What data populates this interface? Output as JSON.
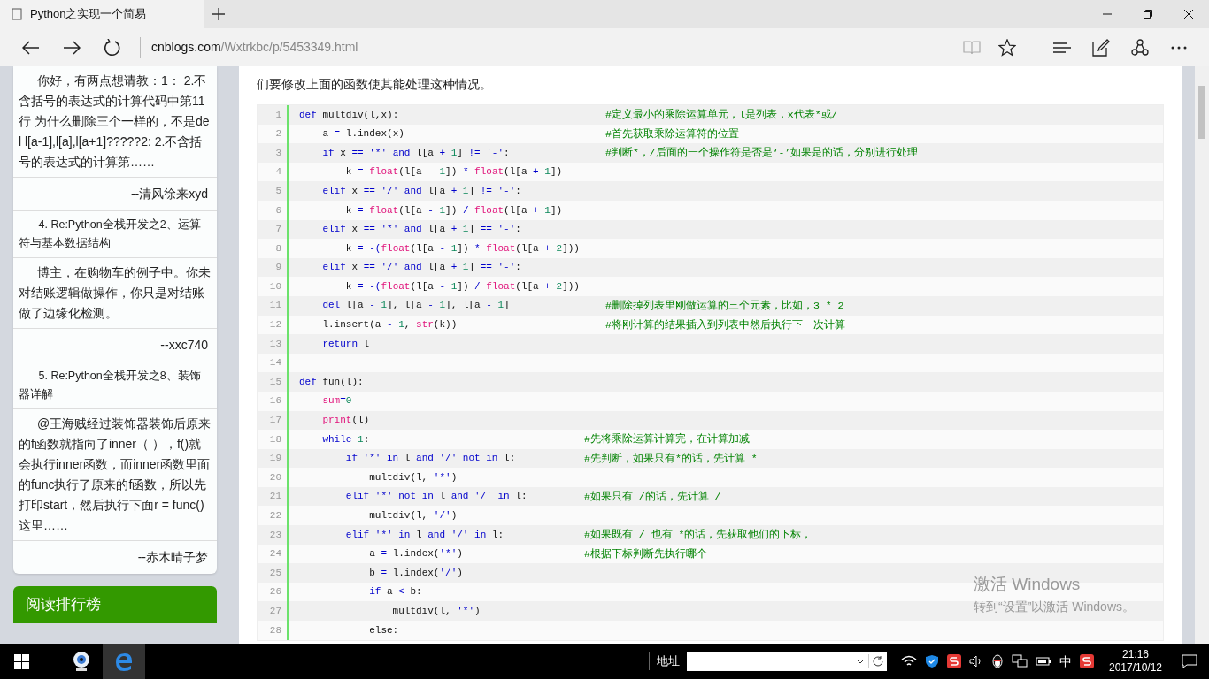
{
  "browser": {
    "tab_title": "Python之实现一个简易",
    "url_host": "cnblogs.com",
    "url_path": "/Wxtrkbc/p/5453349.html"
  },
  "sidebar": {
    "items": [
      {
        "kind": "comment",
        "text": "你好，有两点想请教：1： 2.不含括号的表达式的计算代码中第11行 为什么删除三个一样的，不是del l[a-1],l[a],l[a+1]?????2: 2.不含括号的表达式的计算第……"
      },
      {
        "kind": "author",
        "text": "--清风徐来xyd"
      },
      {
        "kind": "title",
        "text": "4. Re:Python全栈开发之2、运算符与基本数据结构"
      },
      {
        "kind": "comment",
        "text": "博主，在购物车的例子中。你未对结账逻辑做操作，你只是对结账做了边缘化检测。"
      },
      {
        "kind": "author",
        "text": "--xxc740"
      },
      {
        "kind": "title",
        "text": "5. Re:Python全栈开发之8、装饰器详解"
      },
      {
        "kind": "comment",
        "text": "@王海贼经过装饰器装饰后原来的f函数就指向了inner（ ），f()就会执行inner函数，而inner函数里面的func执行了原来的f函数，所以先打印start，然后执行下面r = func() 这里……"
      },
      {
        "kind": "author",
        "text": "--赤木晴子梦"
      }
    ],
    "section_title": "阅读排行榜"
  },
  "article": {
    "paragraph": "们要修改上面的函数使其能处理这种情况。",
    "code_lines": [
      {
        "number": "1",
        "tokens": [
          {
            "kind": "keyword",
            "text": "def"
          },
          {
            "kind": "plain",
            "text": " multdiv(l,x):"
          }
        ],
        "comment": "#定义最小的乘除运算单元，l是列表，x代表*或/"
      },
      {
        "number": "2",
        "tokens": [
          {
            "kind": "plain",
            "text": "    a "
          },
          {
            "kind": "operator",
            "text": "="
          },
          {
            "kind": "plain",
            "text": " l.index(x)"
          }
        ],
        "comment": "#首先获取乘除运算符的位置"
      },
      {
        "number": "3",
        "tokens": [
          {
            "kind": "keyword",
            "text": "    if"
          },
          {
            "kind": "plain",
            "text": " x "
          },
          {
            "kind": "operator",
            "text": "=="
          },
          {
            "kind": "string",
            "text": " '*'"
          },
          {
            "kind": "keyword",
            "text": " and"
          },
          {
            "kind": "plain",
            "text": " l[a "
          },
          {
            "kind": "operator",
            "text": "+"
          },
          {
            "kind": "number",
            "text": " 1"
          },
          {
            "kind": "plain",
            "text": "] "
          },
          {
            "kind": "operator",
            "text": "!="
          },
          {
            "kind": "string",
            "text": " '-'"
          },
          {
            "kind": "plain",
            "text": ":"
          }
        ],
        "comment": "#判断*，/后面的一个操作符是否是‘-’如果是的话，分别进行处理"
      },
      {
        "number": "4",
        "tokens": [
          {
            "kind": "plain",
            "text": "        k "
          },
          {
            "kind": "operator",
            "text": "="
          },
          {
            "kind": "builtin",
            "text": " float"
          },
          {
            "kind": "plain",
            "text": "(l[a "
          },
          {
            "kind": "operator",
            "text": "-"
          },
          {
            "kind": "number",
            "text": " 1"
          },
          {
            "kind": "plain",
            "text": "]) "
          },
          {
            "kind": "operator",
            "text": "*"
          },
          {
            "kind": "builtin",
            "text": " float"
          },
          {
            "kind": "plain",
            "text": "(l[a "
          },
          {
            "kind": "operator",
            "text": "+"
          },
          {
            "kind": "number",
            "text": " 1"
          },
          {
            "kind": "plain",
            "text": "])"
          }
        ]
      },
      {
        "number": "5",
        "tokens": [
          {
            "kind": "keyword",
            "text": "    elif"
          },
          {
            "kind": "plain",
            "text": " x "
          },
          {
            "kind": "operator",
            "text": "=="
          },
          {
            "kind": "string",
            "text": " '/'"
          },
          {
            "kind": "keyword",
            "text": " and"
          },
          {
            "kind": "plain",
            "text": " l[a "
          },
          {
            "kind": "operator",
            "text": "+"
          },
          {
            "kind": "number",
            "text": " 1"
          },
          {
            "kind": "plain",
            "text": "] "
          },
          {
            "kind": "operator",
            "text": "!="
          },
          {
            "kind": "string",
            "text": " '-'"
          },
          {
            "kind": "plain",
            "text": ":"
          }
        ]
      },
      {
        "number": "6",
        "tokens": [
          {
            "kind": "plain",
            "text": "        k "
          },
          {
            "kind": "operator",
            "text": "="
          },
          {
            "kind": "builtin",
            "text": " float"
          },
          {
            "kind": "plain",
            "text": "(l[a "
          },
          {
            "kind": "operator",
            "text": "-"
          },
          {
            "kind": "number",
            "text": " 1"
          },
          {
            "kind": "plain",
            "text": "]) "
          },
          {
            "kind": "operator",
            "text": "/"
          },
          {
            "kind": "builtin",
            "text": " float"
          },
          {
            "kind": "plain",
            "text": "(l[a "
          },
          {
            "kind": "operator",
            "text": "+"
          },
          {
            "kind": "number",
            "text": " 1"
          },
          {
            "kind": "plain",
            "text": "])"
          }
        ]
      },
      {
        "number": "7",
        "tokens": [
          {
            "kind": "keyword",
            "text": "    elif"
          },
          {
            "kind": "plain",
            "text": " x "
          },
          {
            "kind": "operator",
            "text": "=="
          },
          {
            "kind": "string",
            "text": " '*'"
          },
          {
            "kind": "keyword",
            "text": " and"
          },
          {
            "kind": "plain",
            "text": " l[a "
          },
          {
            "kind": "operator",
            "text": "+"
          },
          {
            "kind": "number",
            "text": " 1"
          },
          {
            "kind": "plain",
            "text": "] "
          },
          {
            "kind": "operator",
            "text": "=="
          },
          {
            "kind": "string",
            "text": " '-'"
          },
          {
            "kind": "plain",
            "text": ":"
          }
        ]
      },
      {
        "number": "8",
        "tokens": [
          {
            "kind": "plain",
            "text": "        k "
          },
          {
            "kind": "operator",
            "text": "="
          },
          {
            "kind": "operator",
            "text": " -("
          },
          {
            "kind": "builtin",
            "text": "float"
          },
          {
            "kind": "plain",
            "text": "(l[a "
          },
          {
            "kind": "operator",
            "text": "-"
          },
          {
            "kind": "number",
            "text": " 1"
          },
          {
            "kind": "plain",
            "text": "]) "
          },
          {
            "kind": "operator",
            "text": "*"
          },
          {
            "kind": "builtin",
            "text": " float"
          },
          {
            "kind": "plain",
            "text": "(l[a "
          },
          {
            "kind": "operator",
            "text": "+"
          },
          {
            "kind": "number",
            "text": " 2"
          },
          {
            "kind": "plain",
            "text": "]))"
          }
        ]
      },
      {
        "number": "9",
        "tokens": [
          {
            "kind": "keyword",
            "text": "    elif"
          },
          {
            "kind": "plain",
            "text": " x "
          },
          {
            "kind": "operator",
            "text": "=="
          },
          {
            "kind": "string",
            "text": " '/'"
          },
          {
            "kind": "keyword",
            "text": " and"
          },
          {
            "kind": "plain",
            "text": " l[a "
          },
          {
            "kind": "operator",
            "text": "+"
          },
          {
            "kind": "number",
            "text": " 1"
          },
          {
            "kind": "plain",
            "text": "] "
          },
          {
            "kind": "operator",
            "text": "=="
          },
          {
            "kind": "string",
            "text": " '-'"
          },
          {
            "kind": "plain",
            "text": ":"
          }
        ]
      },
      {
        "number": "10",
        "tokens": [
          {
            "kind": "plain",
            "text": "        k "
          },
          {
            "kind": "operator",
            "text": "="
          },
          {
            "kind": "operator",
            "text": " -("
          },
          {
            "kind": "builtin",
            "text": "float"
          },
          {
            "kind": "plain",
            "text": "(l[a "
          },
          {
            "kind": "operator",
            "text": "-"
          },
          {
            "kind": "number",
            "text": " 1"
          },
          {
            "kind": "plain",
            "text": "]) "
          },
          {
            "kind": "operator",
            "text": "/"
          },
          {
            "kind": "builtin",
            "text": " float"
          },
          {
            "kind": "plain",
            "text": "(l[a "
          },
          {
            "kind": "operator",
            "text": "+"
          },
          {
            "kind": "number",
            "text": " 2"
          },
          {
            "kind": "plain",
            "text": "]))"
          }
        ]
      },
      {
        "number": "11",
        "tokens": [
          {
            "kind": "keyword",
            "text": "    del"
          },
          {
            "kind": "plain",
            "text": " l[a "
          },
          {
            "kind": "operator",
            "text": "-"
          },
          {
            "kind": "number",
            "text": " 1"
          },
          {
            "kind": "plain",
            "text": "], l[a "
          },
          {
            "kind": "operator",
            "text": "-"
          },
          {
            "kind": "number",
            "text": " 1"
          },
          {
            "kind": "plain",
            "text": "], l[a "
          },
          {
            "kind": "operator",
            "text": "-"
          },
          {
            "kind": "number",
            "text": " 1"
          },
          {
            "kind": "plain",
            "text": "]"
          }
        ],
        "comment": "#删除掉列表里刚做运算的三个元素，比如，3 * 2"
      },
      {
        "number": "12",
        "tokens": [
          {
            "kind": "plain",
            "text": "    l.insert(a "
          },
          {
            "kind": "operator",
            "text": "-"
          },
          {
            "kind": "number",
            "text": " 1"
          },
          {
            "kind": "plain",
            "text": ", "
          },
          {
            "kind": "builtin",
            "text": "str"
          },
          {
            "kind": "plain",
            "text": "(k))"
          }
        ],
        "comment": "#将刚计算的结果插入到列表中然后执行下一次计算"
      },
      {
        "number": "13",
        "tokens": [
          {
            "kind": "keyword",
            "text": "    return"
          },
          {
            "kind": "plain",
            "text": " l"
          }
        ]
      },
      {
        "number": "14"
      },
      {
        "number": "15",
        "tokens": [
          {
            "kind": "keyword",
            "text": "def"
          },
          {
            "kind": "plain",
            "text": " fun(l):"
          }
        ]
      },
      {
        "number": "16",
        "tokens": [
          {
            "kind": "builtin",
            "text": "    sum"
          },
          {
            "kind": "operator",
            "text": "="
          },
          {
            "kind": "number",
            "text": "0"
          }
        ]
      },
      {
        "number": "17",
        "tokens": [
          {
            "kind": "builtin",
            "text": "    print"
          },
          {
            "kind": "plain",
            "text": "(l)"
          }
        ]
      },
      {
        "number": "18",
        "tokens": [
          {
            "kind": "keyword",
            "text": "    while"
          },
          {
            "kind": "number",
            "text": " 1"
          },
          {
            "kind": "plain",
            "text": ":"
          }
        ],
        "comment": "#先将乘除运算计算完，在计算加减"
      },
      {
        "number": "19",
        "tokens": [
          {
            "kind": "keyword",
            "text": "        if"
          },
          {
            "kind": "string",
            "text": " '*'"
          },
          {
            "kind": "keyword",
            "text": " in"
          },
          {
            "kind": "plain",
            "text": " l "
          },
          {
            "kind": "keyword",
            "text": "and"
          },
          {
            "kind": "string",
            "text": " '/'"
          },
          {
            "kind": "keyword",
            "text": " not in"
          },
          {
            "kind": "plain",
            "text": " l:"
          }
        ],
        "comment": "#先判断，如果只有*的话，先计算 *"
      },
      {
        "number": "20",
        "tokens": [
          {
            "kind": "plain",
            "text": "            multdiv(l, "
          },
          {
            "kind": "string",
            "text": "'*'"
          },
          {
            "kind": "plain",
            "text": ")"
          }
        ]
      },
      {
        "number": "21",
        "tokens": [
          {
            "kind": "keyword",
            "text": "        elif"
          },
          {
            "kind": "string",
            "text": " '*'"
          },
          {
            "kind": "keyword",
            "text": " not in"
          },
          {
            "kind": "plain",
            "text": " l "
          },
          {
            "kind": "keyword",
            "text": "and"
          },
          {
            "kind": "string",
            "text": " '/'"
          },
          {
            "kind": "keyword",
            "text": " in"
          },
          {
            "kind": "plain",
            "text": " l:"
          }
        ],
        "comment": "#如果只有 /的话，先计算 /"
      },
      {
        "number": "22",
        "tokens": [
          {
            "kind": "plain",
            "text": "            multdiv(l, "
          },
          {
            "kind": "string",
            "text": "'/'"
          },
          {
            "kind": "plain",
            "text": ")"
          }
        ]
      },
      {
        "number": "23",
        "tokens": [
          {
            "kind": "keyword",
            "text": "        elif"
          },
          {
            "kind": "string",
            "text": " '*'"
          },
          {
            "kind": "keyword",
            "text": " in"
          },
          {
            "kind": "plain",
            "text": " l "
          },
          {
            "kind": "keyword",
            "text": "and"
          },
          {
            "kind": "string",
            "text": " '/'"
          },
          {
            "kind": "keyword",
            "text": " in"
          },
          {
            "kind": "plain",
            "text": " l:"
          }
        ],
        "comment": "#如果既有 / 也有 *的话，先获取他们的下标，"
      },
      {
        "number": "24",
        "tokens": [
          {
            "kind": "plain",
            "text": "            a "
          },
          {
            "kind": "operator",
            "text": "="
          },
          {
            "kind": "plain",
            "text": " l.index("
          },
          {
            "kind": "string",
            "text": "'*'"
          },
          {
            "kind": "plain",
            "text": ")"
          }
        ],
        "comment": "#根据下标判断先执行哪个"
      },
      {
        "number": "25",
        "tokens": [
          {
            "kind": "plain",
            "text": "            b "
          },
          {
            "kind": "operator",
            "text": "="
          },
          {
            "kind": "plain",
            "text": " l.index("
          },
          {
            "kind": "string",
            "text": "'/'"
          },
          {
            "kind": "plain",
            "text": ")"
          }
        ]
      },
      {
        "number": "26",
        "tokens": [
          {
            "kind": "keyword",
            "text": "            if"
          },
          {
            "kind": "plain",
            "text": " a "
          },
          {
            "kind": "operator",
            "text": "<"
          },
          {
            "kind": "plain",
            "text": " b:"
          }
        ]
      },
      {
        "number": "27",
        "tokens": [
          {
            "kind": "plain",
            "text": "                multdiv(l, "
          },
          {
            "kind": "string",
            "text": "'*'"
          },
          {
            "kind": "plain",
            "text": ")"
          }
        ]
      },
      {
        "number": "28",
        "tokens": [
          {
            "kind": "plain",
            "text": "            else:"
          }
        ]
      }
    ]
  },
  "activation_notice": {
    "title": "激活 Windows",
    "text": "转到“设置”以激活 Windows。"
  },
  "taskbar": {
    "address_label": "地址",
    "ime": "中",
    "time": "21:16",
    "date": "2017/10/12"
  }
}
